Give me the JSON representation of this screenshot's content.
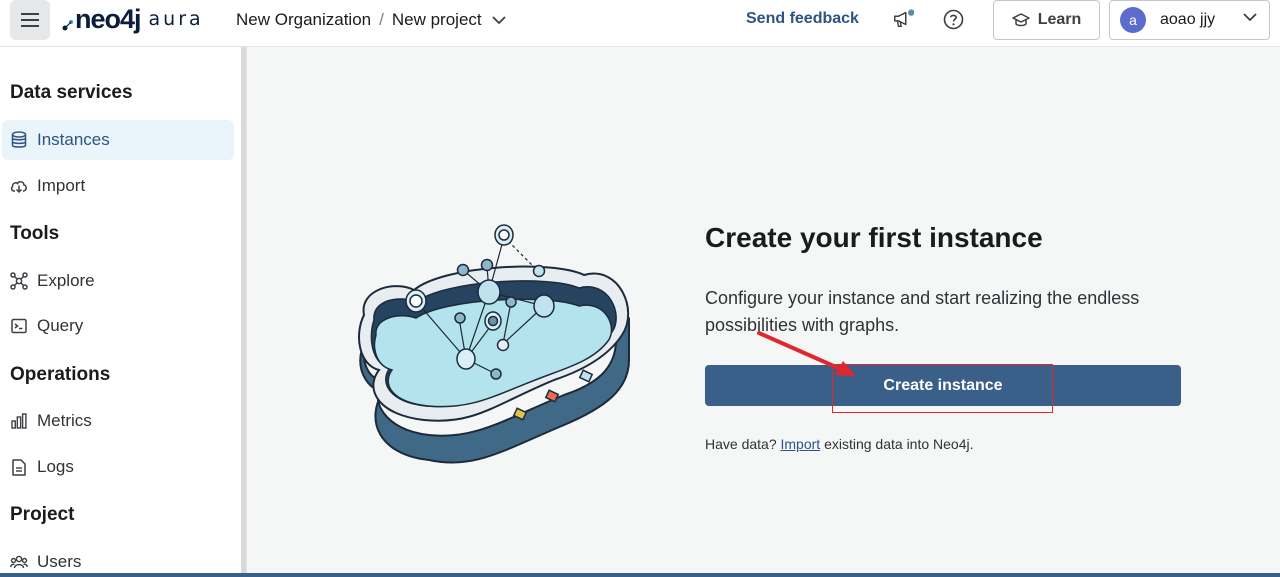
{
  "header": {
    "logo_main": "neo4j",
    "logo_sub": "aura",
    "breadcrumb_org": "New Organization",
    "breadcrumb_sep": "/",
    "breadcrumb_project": "New project",
    "send_feedback": "Send feedback",
    "learn_label": "Learn",
    "avatar_letter": "a",
    "user_name": "aoao jjy"
  },
  "sidebar": {
    "sections": [
      {
        "title": "Data services"
      },
      {
        "title": "Tools"
      },
      {
        "title": "Operations"
      },
      {
        "title": "Project"
      }
    ],
    "items": [
      {
        "label": "Instances",
        "icon": "database-icon",
        "active": true
      },
      {
        "label": "Import",
        "icon": "cloud-download-icon"
      },
      {
        "label": "Explore",
        "icon": "graph-icon"
      },
      {
        "label": "Query",
        "icon": "terminal-icon"
      },
      {
        "label": "Metrics",
        "icon": "bar-chart-icon"
      },
      {
        "label": "Logs",
        "icon": "document-icon"
      },
      {
        "label": "Users",
        "icon": "users-icon"
      }
    ]
  },
  "main": {
    "title": "Create your first instance",
    "description": "Configure your instance and start realizing the endless possibilities with graphs.",
    "create_button": "Create instance",
    "have_data_prefix": "Have data?",
    "import_link": "Import",
    "have_data_suffix": "existing data into Neo4j."
  },
  "colors": {
    "accent": "#3a5f89",
    "active_nav_bg": "#eaf4fb",
    "annotation_red": "#e1262d"
  }
}
